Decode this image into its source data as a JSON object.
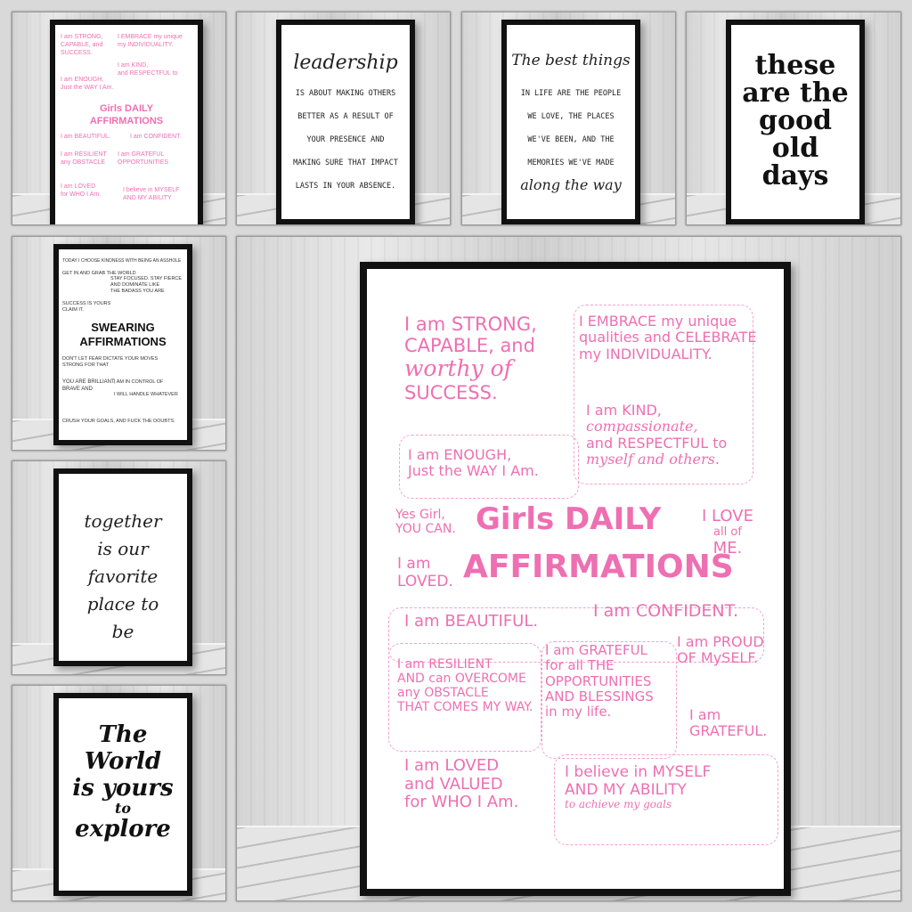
{
  "posters": {
    "leadership": {
      "title": "leadership",
      "lines": [
        "IS ABOUT MAKING OTHERS",
        "BETTER AS A RESULT OF",
        "YOUR PRESENCE AND",
        "MAKING SURE THAT IMPACT",
        "LASTS IN YOUR ABSENCE."
      ]
    },
    "best_things": {
      "title": "The best things",
      "lines": [
        "IN LIFE ARE THE PEOPLE",
        "WE LOVE, THE PLACES",
        "WE'VE BEEN, AND THE",
        "MEMORIES WE'VE MADE"
      ],
      "footer": "along the way"
    },
    "good_old_days": {
      "lines": [
        "these",
        "are the",
        "good",
        "old",
        "days"
      ]
    },
    "swearing": {
      "title_line1": "SWEARING",
      "title_line2": "AFFIRMATIONS",
      "top": "TODAY I CHOOSE KINDNESS WITH BEING AN ASSHOLE",
      "blocks": [
        "GET IN AND GRAB THE WORLD",
        "STAY FOCUSED. STAY FIERCE",
        "AND DOMINATE LIKE",
        "THE BADASS YOU ARE",
        "SUCCESS IS YOURS",
        "CLAIM IT.",
        "DON'T LET FEAR DICTATE YOUR MOVES",
        "STRONG FOR THAT",
        "YOU ARE BRILLIANT,",
        "BRAVE AND",
        "I AM IN CONTROL OF",
        "I WILL HANDLE WHATEVER",
        "CRUSH YOUR GOALS, AND FUCK THE DOUBTS."
      ]
    },
    "together": {
      "lines": [
        "together",
        "is our",
        "favorite",
        "place to",
        "be"
      ]
    },
    "world": {
      "lines": [
        "The",
        "World",
        "is yours",
        "to",
        "explore"
      ]
    },
    "affirmations": {
      "title_line1": "Girls DAILY",
      "title_line2": "AFFIRMATIONS",
      "items": {
        "strong": [
          "I am STRONG,",
          "CAPABLE, and",
          "worthy of",
          "SUCCESS."
        ],
        "embrace": [
          "I EMBRACE my unique",
          "qualities and CELEBRATE",
          "my INDIVIDUALITY."
        ],
        "kind": [
          "I am KIND,",
          "compassionate,",
          "and RESPECTFUL to",
          "myself and others."
        ],
        "enough": [
          "I am ENOUGH,",
          "Just the WAY I Am."
        ],
        "yes_girl": [
          "Yes Girl,",
          "YOU CAN."
        ],
        "love": [
          "I LOVE",
          "all of",
          "ME."
        ],
        "loved": [
          "I am",
          "LOVED."
        ],
        "beautiful": "I am BEAUTIFUL.",
        "confident": "I am CONFIDENT.",
        "resilient": [
          "I am RESILIENT",
          "AND can OVERCOME",
          "any OBSTACLE",
          "THAT COMES MY WAY."
        ],
        "grateful_for": [
          "I am GRATEFUL",
          "for all THE",
          "OPPORTUNITIES",
          "AND BLESSINGS",
          "in my life."
        ],
        "proud": [
          "I am PROUD",
          "OF MySELF."
        ],
        "grateful": [
          "I am",
          "GRATEFUL."
        ],
        "loved_valued": [
          "I am LOVED",
          "and VALUED",
          "for WHO I Am."
        ],
        "believe": [
          "I believe in MYSELF",
          "AND MY ABILITY",
          "to achieve my goals"
        ]
      }
    }
  },
  "colors": {
    "pink": "#ee6fb2",
    "frame": "#111111",
    "wall": "#d9d9d9"
  }
}
